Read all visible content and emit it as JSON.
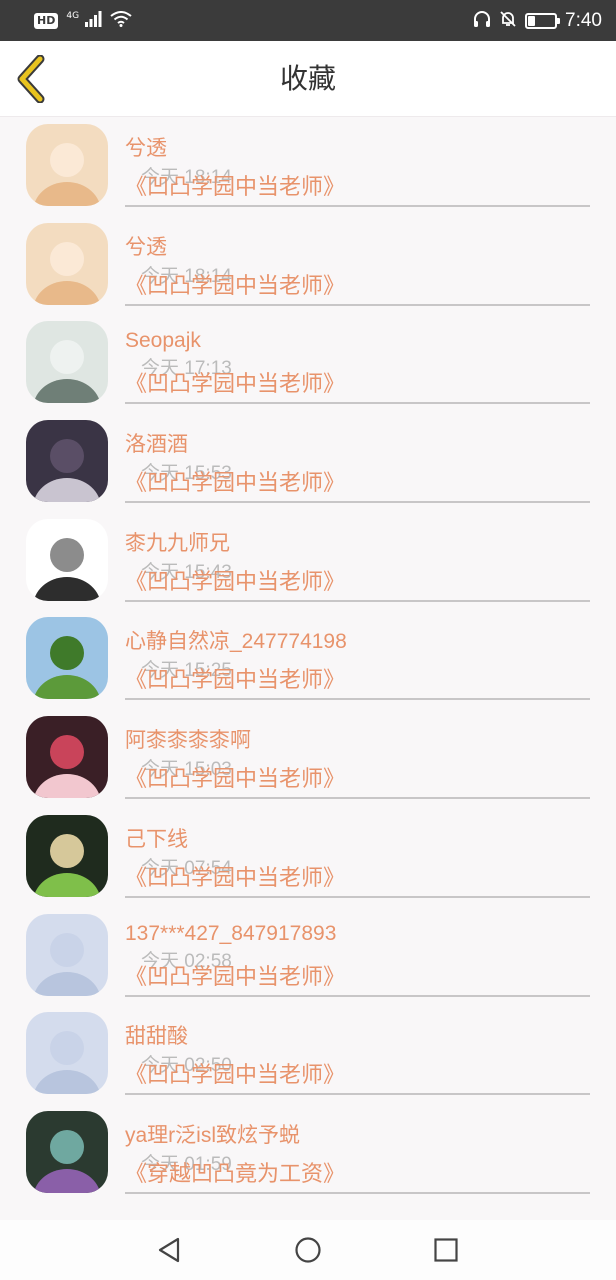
{
  "status_bar": {
    "hd": "HD",
    "network": "4G",
    "time": "7:40",
    "battery_level": 0.25
  },
  "header": {
    "title": "收藏"
  },
  "items": [
    {
      "name": "兮透",
      "time": "今天 18:14",
      "book": "《凹凸学园中当老师》",
      "avatar_colors": [
        "#f3dcc0",
        "#e8b98a",
        "#fbe9d6"
      ]
    },
    {
      "name": "兮透",
      "time": "今天 18:14",
      "book": "《凹凸学园中当老师》",
      "avatar_colors": [
        "#f3dcc0",
        "#e8b98a",
        "#fbe9d6"
      ]
    },
    {
      "name": "Seopajk",
      "time": "今天 17:13",
      "book": "《凹凸学园中当老师》",
      "avatar_colors": [
        "#dfe6e2",
        "#6f7f77",
        "#eef2f0"
      ]
    },
    {
      "name": "洛酒酒",
      "time": "今天 15:53",
      "book": "《凹凸学园中当老师》",
      "avatar_colors": [
        "#3a3445",
        "#c9c4d0",
        "#5a4e66"
      ]
    },
    {
      "name": "桼九九师兄",
      "time": "今天 15:43",
      "book": "《凹凸学园中当老师》",
      "avatar_colors": [
        "#ffffff",
        "#2d2d2d",
        "#8c8c8c"
      ]
    },
    {
      "name": "心静自然凉_247774198",
      "time": "今天 15:25",
      "book": "《凹凸学园中当老师》",
      "avatar_colors": [
        "#9cc4e4",
        "#5c9a3a",
        "#3f7a2a"
      ]
    },
    {
      "name": "阿桼桼桼桼啊",
      "time": "今天 15:03",
      "book": "《凹凸学园中当老师》",
      "avatar_colors": [
        "#3a1f26",
        "#f2c7cf",
        "#c9445a"
      ]
    },
    {
      "name": "己下线",
      "time": "今天 07:54",
      "book": "《凹凸学园中当老师》",
      "avatar_colors": [
        "#1f2b1e",
        "#7fbf4a",
        "#d6c89a"
      ]
    },
    {
      "name": "137***427_847917893",
      "time": "今天 02:58",
      "book": "《凹凸学园中当老师》",
      "avatar_colors": [
        "#d4dced",
        "#b8c5de",
        "#c9d3e8"
      ]
    },
    {
      "name": "甜甜酸",
      "time": "今天 02:50",
      "book": "《凹凸学园中当老师》",
      "avatar_colors": [
        "#d4dced",
        "#b8c5de",
        "#c9d3e8"
      ]
    },
    {
      "name": "ya理r泛isl致炫予蜕",
      "time": "今天 01:59",
      "book": "《穿越凹凸竟为工资》",
      "avatar_colors": [
        "#2b3a30",
        "#8a5fa8",
        "#6fa8a0"
      ]
    }
  ],
  "colors": {
    "accent": "#e8936b",
    "time_text": "#bbbbbb",
    "back_arrow": "#e8c31f"
  }
}
